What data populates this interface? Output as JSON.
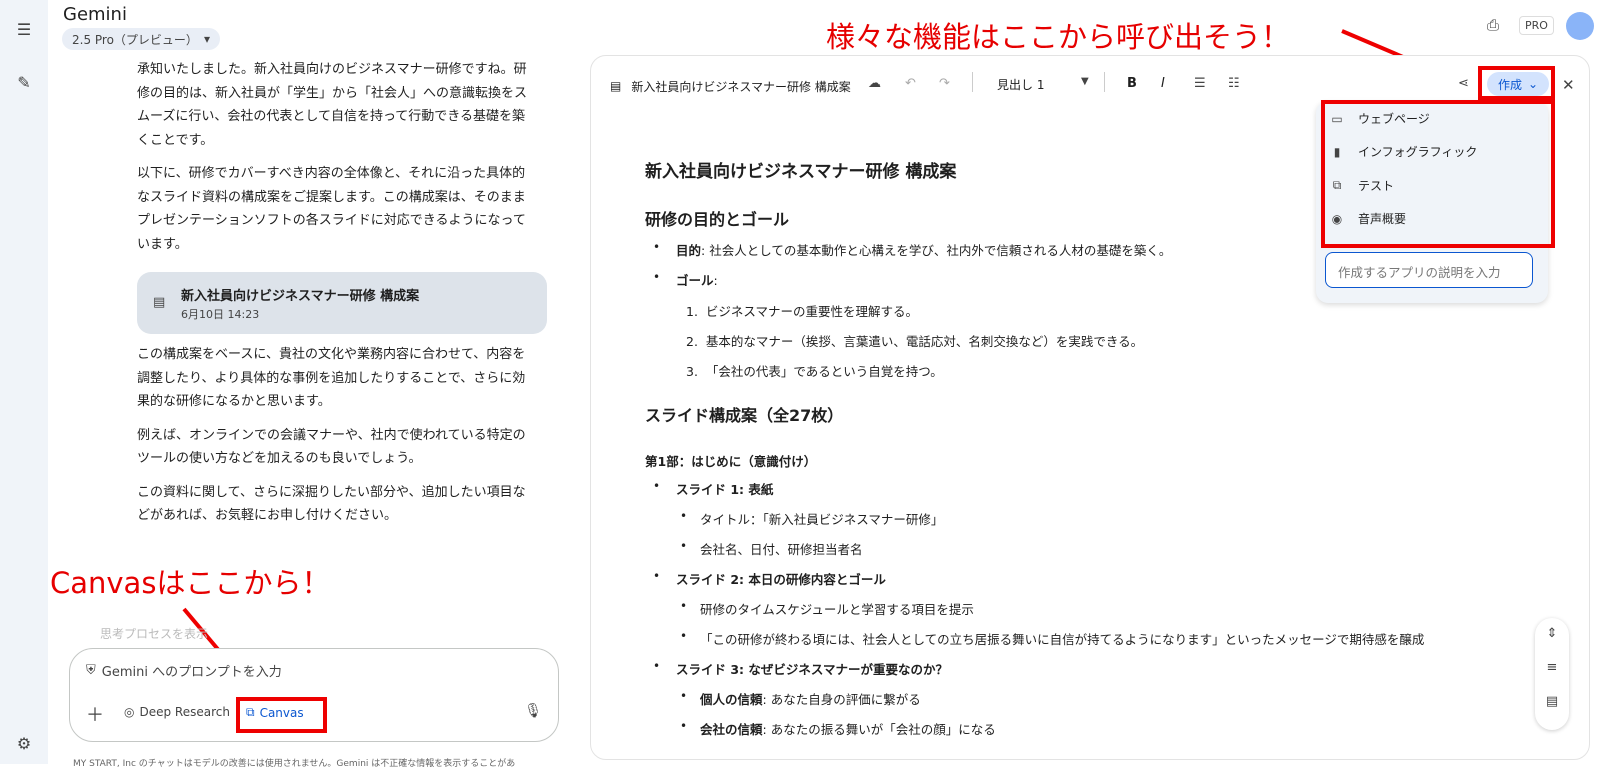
{
  "app": {
    "title": "Gemini",
    "model": "2.5 Pro（プレビュー）"
  },
  "header": {
    "pro_label": "PRO"
  },
  "chat": {
    "paragraphs": [
      "承知いたしました。新入社員向けのビジネスマナー研修ですね。研修の目的は、新入社員が「学生」から「社会人」への意識転換をスムーズに行い、会社の代表として自信を持って行動できる基礎を築くことです。",
      "以下に、研修でカバーすべき内容の全体像と、それに沿った具体的なスライド資料の構成案をご提案します。この構成案は、そのままプレゼンテーションソフトの各スライドに対応できるようになっています。"
    ],
    "chip": {
      "title": "新入社員向けビジネスマナー研修 構成案",
      "date": "6月10日 14:23"
    },
    "paragraphs_after": [
      "この構成案をベースに、貴社の文化や業務内容に合わせて、内容を調整したり、より具体的な事例を追加したりすることで、さらに効果的な研修になるかと思います。",
      "例えば、オンラインでの会議マナーや、社内で使われている特定のツールの使い方などを加えるのも良いでしょう。",
      "この資料に関して、さらに深掘りしたい部分や、追加したい項目などがあれば、お気軽にお申し付けください。"
    ],
    "thinking": "思考プロセスを表示"
  },
  "input": {
    "placeholder": "Gemini へのプロンプトを入力",
    "deep_research": "Deep Research",
    "canvas": "Canvas"
  },
  "footer": "MY START, Inc のチャットはモデルの改善には使用されません。Gemini は不正確な情報を表示することがあ",
  "annotations": {
    "canvas": "Canvasはここから！",
    "features": "様々な機能はここから呼び出そう！"
  },
  "editor": {
    "doc_name": "新入社員向けビジネスマナー研修 構成案",
    "heading_select": "見出し 1",
    "create_label": "作成",
    "menu": [
      "ウェブページ",
      "インフォグラフィック",
      "テスト",
      "音声概要"
    ],
    "menu_input_placeholder": "作成するアプリの説明を入力"
  },
  "doc": {
    "title": "新入社員向けビジネスマナー研修 構成案",
    "h_goal": "研修の目的とゴール",
    "purpose_label": "目的",
    "purpose_text": ": 社会人としての基本動作と心構えを学び、社内外で信頼される人材の基礎を築く。",
    "goal_label": "ゴール",
    "goal_colon": ":",
    "goals": [
      {
        "n": "1.",
        "text": "ビジネスマナーの重要性を理解する。"
      },
      {
        "n": "2.",
        "text": "基本的なマナー（挨拶、言葉遣い、電話応対、名刺交換など）を実践できる。"
      },
      {
        "n": "3.",
        "text": "「会社の代表」であるという自覚を持つ。"
      }
    ],
    "h_slides": "スライド構成案（全27枚）",
    "part1": "第1部：はじめに（意識付け）",
    "s1": "スライド 1: 表紙",
    "s1_items": [
      "タイトル：「新入社員ビジネスマナー研修」",
      "会社名、日付、研修担当者名"
    ],
    "s2": "スライド 2: 本日の研修内容とゴール",
    "s2_items": [
      "研修のタイムスケジュールと学習する項目を提示",
      "「この研修が終わる頃には、社会人としての立ち居振る舞いに自信が持てるようになります」といったメッセージで期待感を醸成"
    ],
    "s3": "スライド 3: なぜビジネスマナーが重要なのか？",
    "s3_a_label": "個人の信頼",
    "s3_a_text": ": あなた自身の評価に繋がる",
    "s3_b_label": "会社の信頼",
    "s3_b_text": ": あなたの振る舞いが「会社の顔」になる"
  }
}
